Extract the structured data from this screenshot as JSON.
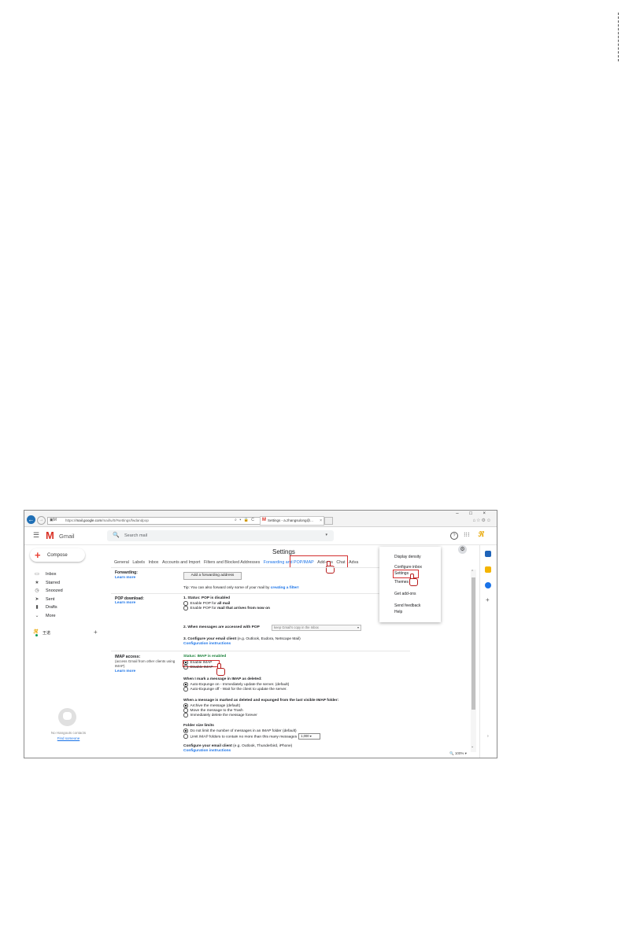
{
  "browser": {
    "address_url_prefix": "https://",
    "address_url_domain": "mail.google.com",
    "address_url_path": "/mail/u/0/#settings/fwdandpop",
    "address_tools": "⌕ ▾ 🔒 C",
    "tab_title": "Settings - a.zhangsulong@...",
    "tab_close": "×",
    "window_controls": "– □ ×",
    "zoom": "100%"
  },
  "header": {
    "app_name": "Gmail",
    "search_placeholder": "Search mail"
  },
  "sidebar": {
    "compose_label": "Compose",
    "items": [
      {
        "label": "Inbox",
        "icon": "inbox-icon"
      },
      {
        "label": "Starred",
        "icon": "star-icon"
      },
      {
        "label": "Snoozed",
        "icon": "clock-icon"
      },
      {
        "label": "Sent",
        "icon": "send-icon"
      },
      {
        "label": "Drafts",
        "icon": "draft-icon"
      },
      {
        "label": "More",
        "icon": "chevron-down-icon"
      }
    ],
    "hangouts_user": "王诺",
    "no_contacts": "No Hangouts contacts",
    "find_someone": "Find someone"
  },
  "settings": {
    "title": "Settings",
    "tabs": [
      "General",
      "Labels",
      "Inbox",
      "Accounts and Import",
      "Filters and Blocked Addresses",
      "Forwarding and POP/IMAP",
      "Add-ons",
      "Chat",
      "Adva"
    ],
    "active_tab_index": 5,
    "forwarding": {
      "label": "Forwarding:",
      "learn_more": "Learn more",
      "button": "Add a forwarding address",
      "tip_prefix": "Tip: You can also forward only some of your mail by ",
      "tip_link": "creating a filter!"
    },
    "pop": {
      "label": "POP download:",
      "learn_more": "Learn more",
      "status_line": "1. Status: POP is disabled",
      "opt1_prefix": "Enable POP for ",
      "opt1_bold": "all mail",
      "opt2_prefix": "Enable POP for ",
      "opt2_bold": "mail that arrives from now on",
      "step2": "2. When messages are accessed with POP",
      "step2_select": "keep Gmail's copy in the Inbox",
      "step3_bold": "3. Configure your email client",
      "step3_rest": " (e.g. Outlook, Eudora, Netscape Mail)",
      "config_link": "Configuration instructions"
    },
    "imap": {
      "label": "IMAP access:",
      "sub1": "(access Gmail from other clients using",
      "sub2": "IMAP)",
      "learn_more": "Learn more",
      "status": "Status: IMAP is enabled",
      "enable": "Enable IMAP",
      "disable": "Disable IMAP",
      "deleted_heading": "When I mark a message in IMAP as deleted:",
      "del_opt1": "Auto-Expunge on - Immediately update the server. (default)",
      "del_opt2": "Auto-Expunge off - Wait for the client to update the server.",
      "expunge_heading": "When a message is marked as deleted and expunged from the last visible IMAP folder:",
      "exp_opt1": "Archive the message (default)",
      "exp_opt2": "Move the message to the Trash",
      "exp_opt3": "Immediately delete the message forever",
      "folder_heading": "Folder size limits",
      "folder_opt1": "Do not limit the number of messages in an IMAP folder (default)",
      "folder_opt2": "Limit IMAP folders to contain no more than this many messages",
      "folder_select": "1,000",
      "client_bold": "Configure your email client",
      "client_rest": " (e.g. Outlook, Thunderbird, iPhone)",
      "config_link": "Configuration instructions"
    }
  },
  "menu": {
    "items": [
      "Display density",
      "Configure inbox",
      "Settings",
      "Themes",
      "Get add-ons",
      "Send feedback",
      "Help"
    ],
    "selected": "Settings"
  },
  "colors": {
    "gmail_red": "#d93025",
    "link_blue": "#1a73e8",
    "status_green": "#188038",
    "highlight_red": "#d32f2f"
  }
}
